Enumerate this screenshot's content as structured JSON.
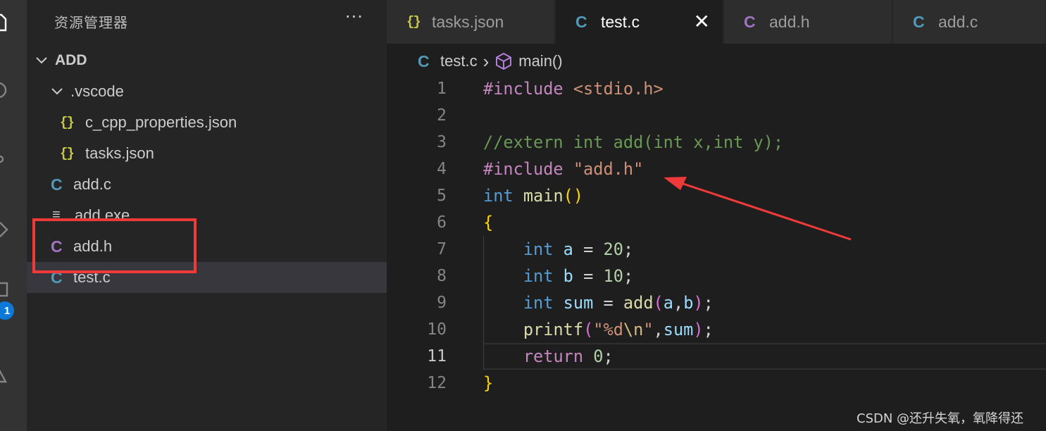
{
  "colors": {
    "c_icon_blue": "#519aba",
    "h_icon_purple": "#a074c4",
    "json_icon_yellow": "#cbcb41",
    "annotation_red": "#f03a3a",
    "badge_blue": "#0a79d7"
  },
  "activity_bar": {
    "icons": [
      "explorer-icon",
      "search-icon",
      "source-control-icon",
      "run-debug-icon",
      "extensions-icon",
      "testing-icon"
    ],
    "badge": "1"
  },
  "sidebar": {
    "title": "资源管理器",
    "more": "···",
    "root": "ADD",
    "tree": [
      {
        "kind": "folder",
        "icon": "chevron-down-icon",
        "label": ".vscode"
      },
      {
        "kind": "json",
        "icon": "{}",
        "label": "c_cpp_properties.json"
      },
      {
        "kind": "json",
        "icon": "{}",
        "label": "tasks.json"
      },
      {
        "kind": "c",
        "icon": "C",
        "label": "add.c"
      },
      {
        "kind": "exe",
        "icon": "≡",
        "label": "add.exe"
      },
      {
        "kind": "h",
        "icon": "C",
        "label": "add.h"
      },
      {
        "kind": "c",
        "icon": "C",
        "label": "test.c",
        "selected": true
      }
    ]
  },
  "tabs": [
    {
      "icon": "{}",
      "label": "tasks.json",
      "active": false
    },
    {
      "icon": "C",
      "label": "test.c",
      "active": true,
      "close": "✕"
    },
    {
      "icon": "C",
      "label": "add.h",
      "active": false
    },
    {
      "icon": "C",
      "label": "add.c",
      "active": false
    }
  ],
  "breadcrumb": {
    "file_icon": "C",
    "file": "test.c",
    "separator": "›",
    "symbol": "main()"
  },
  "editor": {
    "current_line": 11,
    "line_numbers": [
      "1",
      "2",
      "3",
      "4",
      "5",
      "6",
      "7",
      "8",
      "9",
      "10",
      "11",
      "12"
    ],
    "lines": [
      [
        [
          "pp",
          "#include "
        ],
        [
          "str",
          "<stdio.h>"
        ]
      ],
      [],
      [
        [
          "cm",
          "//extern int add(int x,int y);"
        ]
      ],
      [
        [
          "pp",
          "#include "
        ],
        [
          "str",
          "\"add.h\""
        ]
      ],
      [
        [
          "type",
          "int"
        ],
        [
          "op",
          " "
        ],
        [
          "fn",
          "main"
        ],
        [
          "br1",
          "()"
        ]
      ],
      [
        [
          "br1",
          "{"
        ]
      ],
      [
        [
          "op",
          "    "
        ],
        [
          "type",
          "int"
        ],
        [
          "op",
          " "
        ],
        [
          "var",
          "a"
        ],
        [
          "op",
          " = "
        ],
        [
          "num",
          "20"
        ],
        [
          "op",
          ";"
        ]
      ],
      [
        [
          "op",
          "    "
        ],
        [
          "type",
          "int"
        ],
        [
          "op",
          " "
        ],
        [
          "var",
          "b"
        ],
        [
          "op",
          " = "
        ],
        [
          "num",
          "10"
        ],
        [
          "op",
          ";"
        ]
      ],
      [
        [
          "op",
          "    "
        ],
        [
          "type",
          "int"
        ],
        [
          "op",
          " "
        ],
        [
          "var",
          "sum"
        ],
        [
          "op",
          " = "
        ],
        [
          "fn",
          "add"
        ],
        [
          "br2",
          "("
        ],
        [
          "var",
          "a"
        ],
        [
          "op",
          ","
        ],
        [
          "var",
          "b"
        ],
        [
          "br2",
          ")"
        ],
        [
          "op",
          ";"
        ]
      ],
      [
        [
          "op",
          "    "
        ],
        [
          "fn",
          "printf"
        ],
        [
          "br2",
          "("
        ],
        [
          "str",
          "\"%d"
        ],
        [
          "esc",
          "\\n"
        ],
        [
          "str",
          "\""
        ],
        [
          "op",
          ","
        ],
        [
          "var",
          "sum"
        ],
        [
          "br2",
          ")"
        ],
        [
          "op",
          ";"
        ]
      ],
      [
        [
          "op",
          "    "
        ],
        [
          "kw",
          "return"
        ],
        [
          "op",
          " "
        ],
        [
          "num",
          "0"
        ],
        [
          "op",
          ";"
        ]
      ],
      [
        [
          "br1",
          "}"
        ]
      ]
    ]
  },
  "watermark": "CSDN @还升失氧，氧降得还"
}
